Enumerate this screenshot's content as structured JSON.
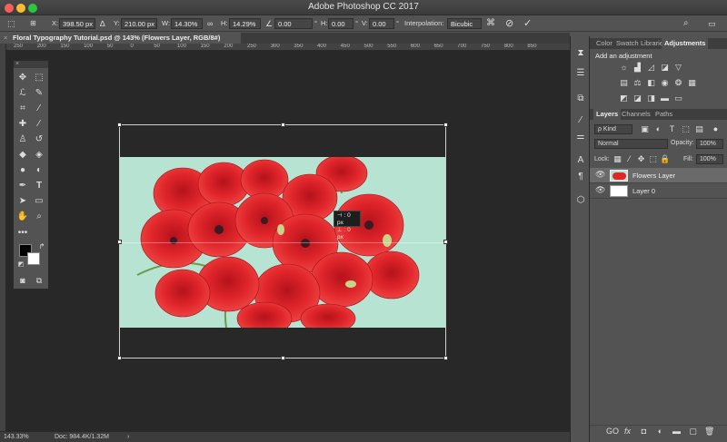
{
  "app": {
    "title": "Adobe Photoshop CC 2017"
  },
  "options_bar": {
    "x_label": "X:",
    "x_value": "398.50 px",
    "y_label": "Y:",
    "y_value": "210.00 px",
    "w_label": "W:",
    "w_value": "14.30%",
    "h_label": "H:",
    "h_value": "14.29%",
    "angle_value": "0.00",
    "angle_unit": "°",
    "hskew_label": "H:",
    "hskew_value": "0.00",
    "vskew_label": "V:",
    "vskew_value": "0.00",
    "skew_unit": "°",
    "interp_label": "Interpolation:",
    "interp_value": "Bicubic"
  },
  "document": {
    "tab_title": "Floral Typography Tutorial.psd @ 143% (Flowers Layer, RGB/8#)"
  },
  "ruler": {
    "ticks": [
      "250",
      "200",
      "150",
      "100",
      "50",
      "0",
      "50",
      "100",
      "150",
      "200",
      "250",
      "300",
      "350",
      "400",
      "450",
      "500",
      "550",
      "600",
      "650",
      "700",
      "750",
      "800",
      "850"
    ]
  },
  "transform_tooltip": {
    "line1": "⊣ : 0 px",
    "line2": "⊥ : 0 px"
  },
  "status": {
    "zoom": "143.33%",
    "doc": "Doc: 984.4K/1.32M",
    "arrow": "›"
  },
  "adjust_panel": {
    "tabs": [
      "Color",
      "Swatch",
      "Librarie",
      "Adjustments"
    ],
    "heading": "Add an adjustment"
  },
  "layers_panel": {
    "tabs": [
      "Layers",
      "Channels",
      "Paths"
    ],
    "kind_filter": "ρ Kind",
    "blend_mode": "Normal",
    "opacity_label": "Opacity:",
    "opacity_value": "100%",
    "lock_label": "Lock:",
    "fill_label": "Fill:",
    "fill_value": "100%",
    "layers": [
      {
        "name": "Flowers Layer",
        "selected": true
      },
      {
        "name": "Layer 0",
        "selected": false
      }
    ],
    "footer_icons": [
      "GO",
      "fx",
      "◘",
      "◐",
      "▬",
      "▢",
      "🗑"
    ]
  },
  "colors": {
    "canvas_bg": "#282828",
    "panel": "#535353",
    "image_bg": "#b7e3d2",
    "poppy": "#e0262b"
  }
}
